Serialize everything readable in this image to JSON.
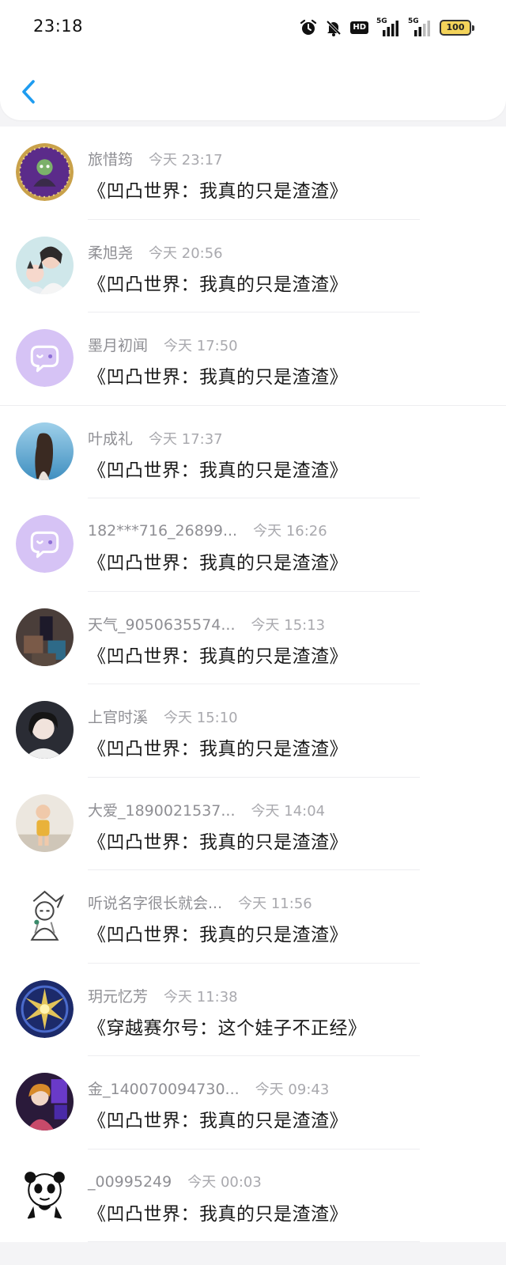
{
  "status_bar": {
    "time": "23:18",
    "net_label_1": "5G",
    "net_label_2": "5G",
    "hd_label": "HD",
    "battery": "100"
  },
  "colors": {
    "accent": "#1e9cf0",
    "placeholder_avatar": "#d6c3f5"
  },
  "messages": [
    {
      "name": "旅惜筠",
      "time": "今天 23:17",
      "text": "《凹凸世界：我真的只是渣渣》",
      "avatar": "purple-badge"
    },
    {
      "name": "柔旭尧",
      "time": "今天 20:56",
      "text": "《凹凸世界：我真的只是渣渣》",
      "avatar": "photo-light"
    },
    {
      "name": "墨月初闻",
      "time": "今天 17:50",
      "text": "《凹凸世界：我真的只是渣渣》",
      "avatar": "chat-placeholder"
    },
    {
      "name": "叶成礼",
      "time": "今天 17:37",
      "text": "《凹凸世界：我真的只是渣渣》",
      "avatar": "photo-blue"
    },
    {
      "name": "182***716_26899...",
      "time": "今天 16:26",
      "text": "《凹凸世界：我真的只是渣渣》",
      "avatar": "chat-placeholder"
    },
    {
      "name": "天气_9050635574...",
      "time": "今天 15:13",
      "text": "《凹凸世界：我真的只是渣渣》",
      "avatar": "photo-dark"
    },
    {
      "name": "上官时溪",
      "time": "今天 15:10",
      "text": "《凹凸世界：我真的只是渣渣》",
      "avatar": "photo-portrait"
    },
    {
      "name": "大爱_1890021537...",
      "time": "今天 14:04",
      "text": "《凹凸世界：我真的只是渣渣》",
      "avatar": "photo-kid"
    },
    {
      "name": "听说名字很长就会...",
      "time": "今天 11:56",
      "text": "《凹凸世界：我真的只是渣渣》",
      "avatar": "sketch"
    },
    {
      "name": "玥元忆芳",
      "time": "今天 11:38",
      "text": "《穿越赛尔号：这个娃子不正经》",
      "avatar": "emblem"
    },
    {
      "name": "金_140070094730...",
      "time": "今天 09:43",
      "text": "《凹凸世界：我真的只是渣渣》",
      "avatar": "anime-dark"
    },
    {
      "name": "_00995249",
      "time": "今天 00:03",
      "text": "《凹凸世界：我真的只是渣渣》",
      "avatar": "panda-meme"
    }
  ]
}
